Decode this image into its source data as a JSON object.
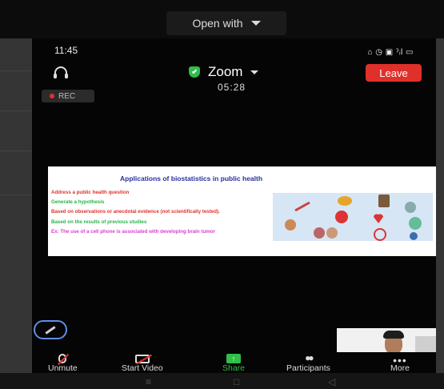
{
  "viewer": {
    "open_with_label": "Open with",
    "nav_glyphs": [
      "≡",
      "□",
      "◁"
    ]
  },
  "status_bar": {
    "time": "11:45",
    "icons": [
      "headset-icon",
      "alarm-icon",
      "mute-icon",
      "signal-icon",
      "battery-icon"
    ],
    "icon_text": "⌂ ◷ ▣ ˀᵢl ▭"
  },
  "meeting": {
    "title": "Zoom",
    "timer": "05:28",
    "leave_label": "Leave",
    "rec_label": "REC"
  },
  "slide": {
    "title": "Applications of biostatistics in public health",
    "bullets": [
      {
        "text": "Address a public health question",
        "color": "#e0302b"
      },
      {
        "text": "Generate a hypothesis",
        "color": "#2bb24c"
      },
      {
        "text": "Based on observations or anecdotal evidence (not scientifically tested).",
        "color": "#e0302b"
      },
      {
        "text": "Based on the results of previous studies",
        "color": "#2bb24c"
      },
      {
        "text": "Ex: The use of a cell phone is associated with developing brain tumor",
        "color": "#d63fd1"
      }
    ]
  },
  "toolbar": {
    "unmute": "Unmute",
    "start_video": "Start Video",
    "share": "Share",
    "participants": "Participants",
    "more": "More"
  },
  "colors": {
    "leave": "#e0302b",
    "accent_green": "#2fbf4a",
    "slide_title": "#2a2f9c"
  }
}
